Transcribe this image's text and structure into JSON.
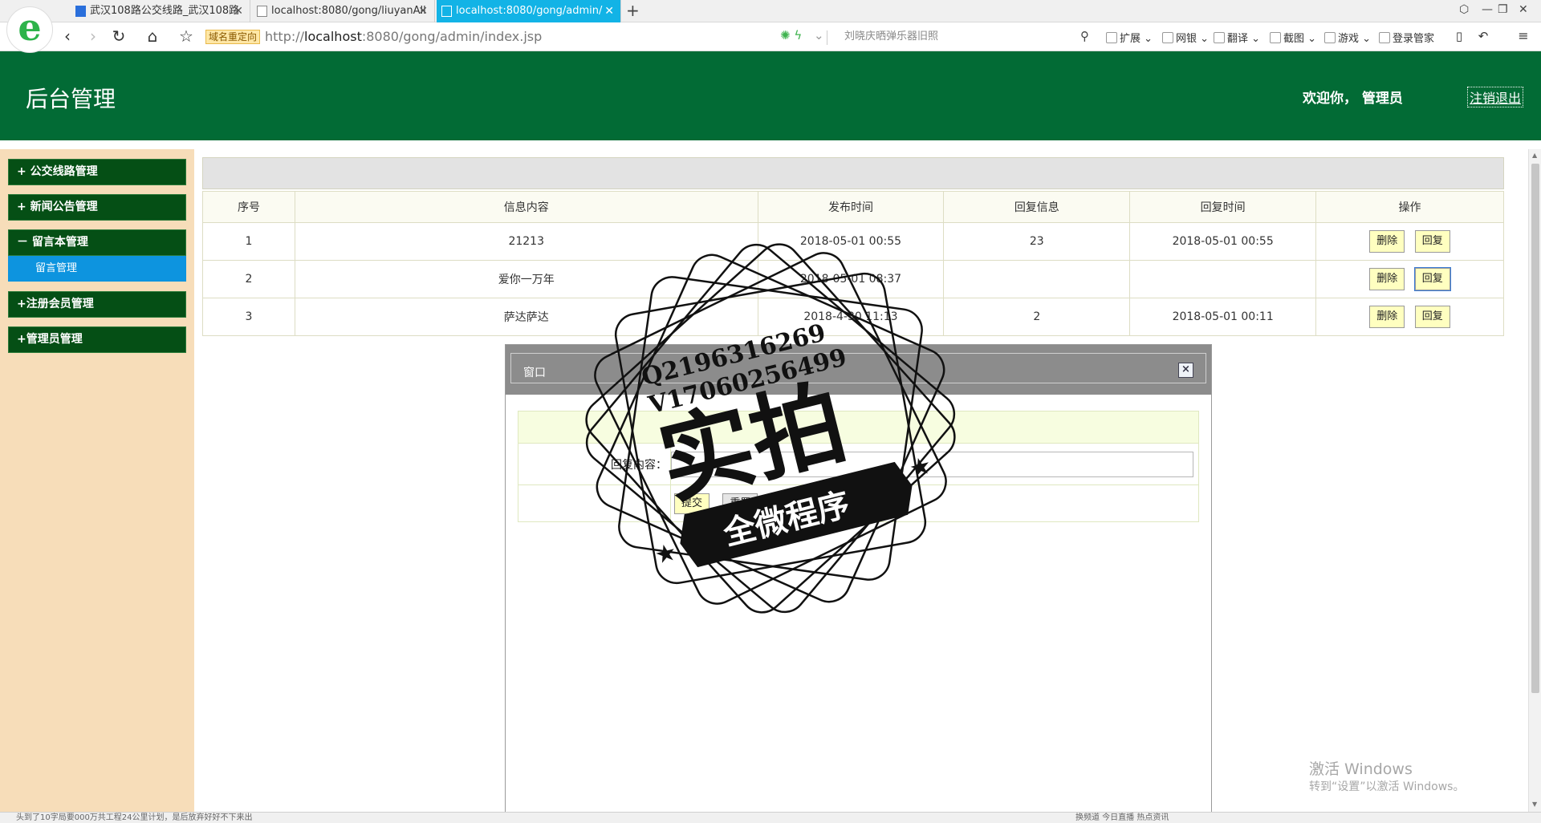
{
  "browser": {
    "tabs": [
      {
        "title": "武汉108路公交线路_武汉108路",
        "active": false
      },
      {
        "title": "localhost:8080/gong/liuyanAll",
        "active": false
      },
      {
        "title": "localhost:8080/gong/admin/",
        "active": true
      }
    ],
    "new_tab": "+",
    "redirect_badge": "域名重定向",
    "url_prefix": "http://",
    "url_host": "localhost",
    "url_rest": ":8080/gong/admin/index.jsp",
    "search_placeholder": "刘晓庆晒弹乐器旧照",
    "toolbar_items": [
      "扩展",
      "网银",
      "翻译",
      "截图",
      "游戏",
      "登录管家"
    ]
  },
  "header": {
    "title": "后台管理",
    "welcome": "欢迎你，  管理员",
    "logout": "注销退出"
  },
  "sidebar": {
    "groups": [
      {
        "label": "+ 公交线路管理"
      },
      {
        "label": "+ 新闻公告管理"
      },
      {
        "label": "－ 留言本管理"
      },
      {
        "label": "+注册会员管理"
      },
      {
        "label": "+管理员管理"
      }
    ],
    "sub_item": "留言管理"
  },
  "table": {
    "columns": [
      "序号",
      "信息内容",
      "发布时间",
      "回复信息",
      "回复时间",
      "操作"
    ],
    "rows": [
      {
        "no": "1",
        "content": "21213",
        "time": "2018-05-01 00:55",
        "reply": "23",
        "reply_time": "2018-05-01 00:55"
      },
      {
        "no": "2",
        "content": "爱你一万年",
        "time": "2018-05-01 08:37",
        "reply": "",
        "reply_time": ""
      },
      {
        "no": "3",
        "content": "萨达萨达",
        "time": "2018-4-30 11:13",
        "reply": "2",
        "reply_time": "2018-05-01 00:11"
      }
    ],
    "delete_label": "删除",
    "reply_label": "回复"
  },
  "dialog": {
    "title": "窗口",
    "close": "×",
    "reply_label": "回复内容：",
    "reply_value": "",
    "submit": "提交",
    "reset": "重置"
  },
  "watermark": {
    "contact1": "Q2196316269",
    "contact2": "V17060256499",
    "big": "实拍",
    "banner": "全微程序"
  },
  "windows_activation": {
    "line1": "激活 Windows",
    "line2": "转到“设置”以激活 Windows。"
  },
  "statusbar": {
    "left": "头到了10字局要000万共工程24公里计划，是后放弃好好不下来出",
    "right": "换频道    今日直播    热点资讯"
  }
}
